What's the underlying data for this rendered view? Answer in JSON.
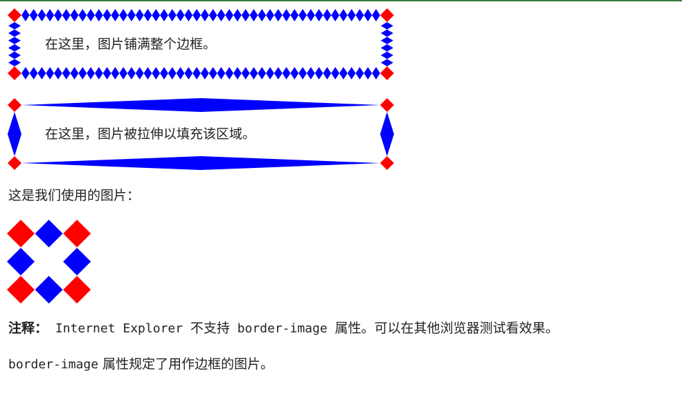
{
  "demo_round": {
    "text": "在这里，图片铺满整个边框。"
  },
  "demo_stretch": {
    "text": "在这里，图片被拉伸以填充该区域。"
  },
  "image_caption": "这是我们使用的图片：",
  "note": {
    "label": "注释：",
    "part1": " Internet Explorer ",
    "part2": "不支持",
    "part3": " border-image ",
    "part4": "属性。可以在其他浏览器测试看效果。"
  },
  "description": {
    "code": "border-image",
    "text": " 属性规定了用作边框的图片。"
  },
  "colors": {
    "corner": "#ff0000",
    "edge": "#0000ff",
    "top_line": "#3a7a3a"
  }
}
